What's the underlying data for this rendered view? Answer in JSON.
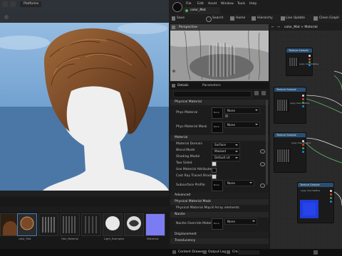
{
  "viewport": {
    "platforms_label": "Platforms"
  },
  "content_browser": {
    "thumbnails": [
      {
        "label": "color_Mat"
      },
      {
        "label": ""
      },
      {
        "label": "Hair_Material"
      },
      {
        "label": ""
      },
      {
        "label": "Light_Examples"
      },
      {
        "label": ""
      },
      {
        "label": "Materials"
      }
    ]
  },
  "bottom_bar": {
    "content_drawer": "Content Drawer",
    "output_log": "Output Log",
    "cmd": "Cmd"
  },
  "editor": {
    "menu": [
      "File",
      "Edit",
      "Asset",
      "Window",
      "Tools",
      "Help"
    ],
    "tab_title": "color_Mat",
    "toolbar": {
      "save": "Save",
      "search": "Search",
      "home": "Home",
      "hierarchy": "Hierarchy",
      "live_update": "Live Update",
      "clean_graph": "Clean Graph"
    },
    "preview_tab": "Perspective",
    "breadcrumb": "color_Mat > Material",
    "details": {
      "tab_details": "Details",
      "tab_parameters": "Parameters",
      "sections": {
        "physical_material": "Physical Material",
        "material": "Material",
        "advanced": "Advanced",
        "physical_material_mask": "Physical Material Mask",
        "nanite": "Nanite",
        "displacement": "Displacement",
        "translucency": "Translucency"
      },
      "phys_material": {
        "label": "Phys Material",
        "value": "None"
      },
      "phys_material_mask": {
        "label": "Phys Material Mask",
        "value": "None"
      },
      "material_domain": {
        "label": "Material Domain",
        "value": "Surface"
      },
      "blend_mode": {
        "label": "Blend Mode",
        "value": "Masked"
      },
      "shading_model": {
        "label": "Shading Model",
        "value": "Default Lit"
      },
      "two_sided": {
        "label": "Two Sided"
      },
      "use_material_attributes": {
        "label": "Use Material Attributes"
      },
      "cast_ray_traced_shadows": {
        "label": "Cast Ray Traced Shadows"
      },
      "subsurface_profile": {
        "label": "Subsurface Profile",
        "value": "None"
      },
      "physical_material_map": {
        "label": "Physical Material Map",
        "value": "8 Array elements"
      },
      "nanite_override_material": {
        "label": "Nanite Override Material",
        "value": "None"
      },
      "none_button": "None"
    },
    "graph_nodes": [
      {
        "title": "Texture Sample"
      },
      {
        "title": "Texture Sample"
      },
      {
        "title": "Texture Sample"
      },
      {
        "title": "Texture Sample"
      }
    ],
    "graph_node_subtitle": "Apply View MipBias"
  },
  "colors": {
    "accent_blue": "#2a7fd4",
    "node_header": "#2a4f72",
    "sky": "#6e9cc8",
    "hair": "#7a4a28"
  }
}
